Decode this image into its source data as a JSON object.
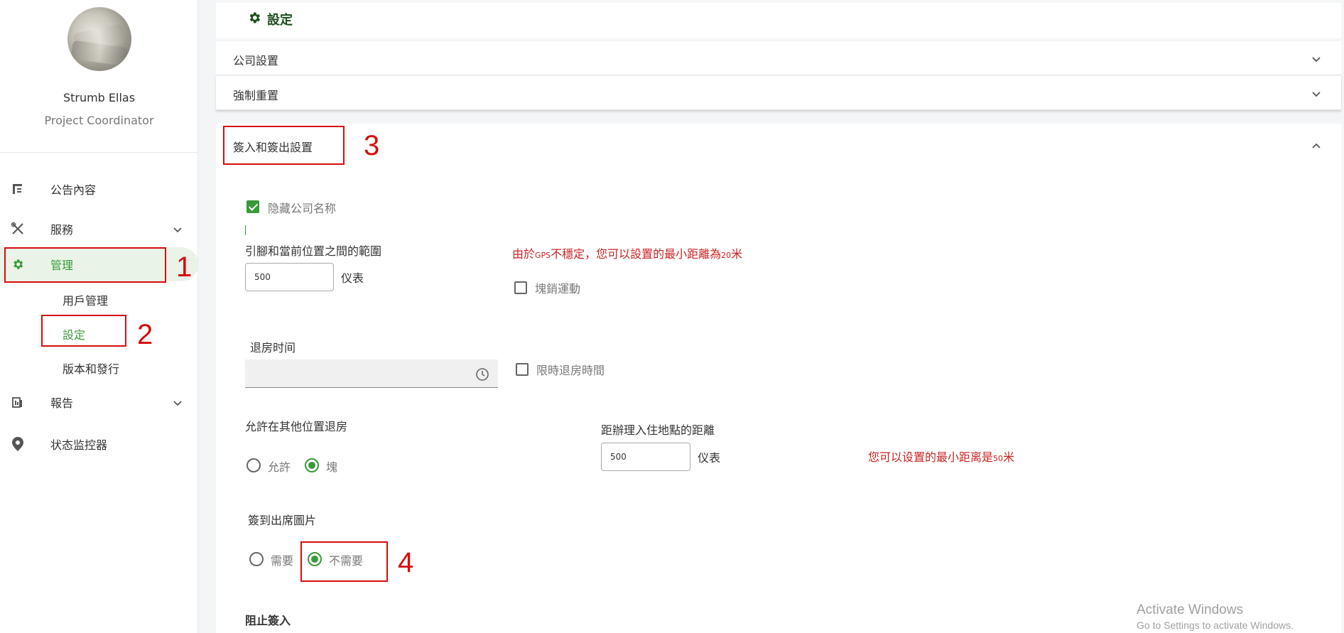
{
  "user": {
    "name": "Strumb Ellas",
    "role": "Project Coordinator"
  },
  "nav": {
    "announcements": "公告內容",
    "services": "服務",
    "management": "管理",
    "sub_user_mgmt": "用戶管理",
    "sub_settings": "設定",
    "sub_version": "版本和發行",
    "reports": "報告",
    "status_monitor": "状态监控器"
  },
  "annotations": {
    "n1": "1",
    "n2": "2",
    "n3": "3",
    "n4": "4"
  },
  "header": {
    "title": "設定"
  },
  "accordions": {
    "company": "公司設置",
    "force_reset": "強制重置",
    "checkin": "簽入和簽出設置"
  },
  "form": {
    "hide_company_name": "隐藏公司名称",
    "range_label": "引腳和當前位置之間的範圍",
    "range_value": "500",
    "range_unit": "仪表",
    "gps_warning_main": "由於",
    "gps_warning_small": "GPS",
    "gps_warning_rest": "不穩定，您可以設置的最小距離為",
    "gps_warning_num": "20",
    "gps_warning_tail": "米",
    "block_sports": "塊銷運動",
    "checkout_time_label": "退房时间",
    "limit_checkout": "限時退房時間",
    "allow_other_label": "允許在其他位置退房",
    "allow": "允許",
    "block": "塊",
    "distance_label": "距辦理入住地點的距離",
    "distance_value": "500",
    "distance_unit": "仪表",
    "min_distance_main": "您可以设置的最小距离是",
    "min_distance_num": "50",
    "min_distance_tail": "米",
    "attendance_photo_label": "簽到出席圖片",
    "need": "需要",
    "not_need": "不需要",
    "block_checkin": "阻止簽入"
  },
  "watermark": {
    "line1": "Activate Windows",
    "line2": "Go to Settings to activate Windows."
  },
  "colors": {
    "accent": "#3a9a3a",
    "annotation": "#d60d0d",
    "warning": "#cc2222"
  }
}
